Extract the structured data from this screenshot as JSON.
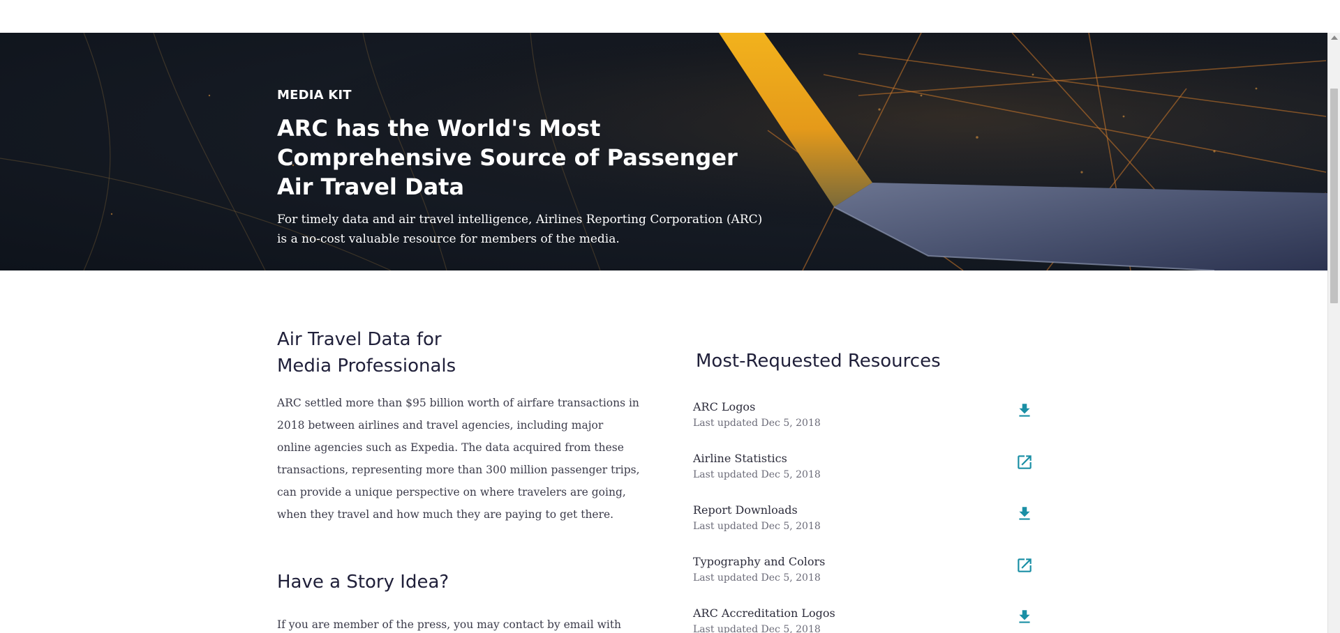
{
  "hero": {
    "kicker": "MEDIA KIT",
    "title": "ARC has the World's Most Comprehensive Source of Passenger Air Travel Data",
    "subtitle": "For timely data and air travel intelligence, Airlines Reporting Corporation (ARC) is a no-cost valuable resource for members of the media."
  },
  "intro": {
    "heading_line1": "Air Travel Data for",
    "heading_line2": "Media Professionals",
    "body": "ARC settled more than $95 billion worth of airfare transactions in 2018 between airlines and travel agencies, including major online agencies such as Expedia. The data acquired from these transactions, representing more than 300 million passenger trips, can provide a unique perspective on where travelers are going, when they travel and how much they are paying to get there."
  },
  "story": {
    "heading": "Have a Story Idea?",
    "body": "If you are member of the press, you may contact by email with your"
  },
  "resources": {
    "heading": "Most-Requested Resources",
    "accent_color": "#1a8fa5",
    "items": [
      {
        "title": "ARC Logos",
        "updated": "Last updated Dec 5, 2018",
        "icon": "download-icon"
      },
      {
        "title": "Airline Statistics",
        "updated": "Last updated Dec 5, 2018",
        "icon": "external-link-icon"
      },
      {
        "title": "Report Downloads",
        "updated": "Last updated Dec 5, 2018",
        "icon": "download-icon"
      },
      {
        "title": "Typography and Colors",
        "updated": "Last updated Dec 5, 2018",
        "icon": "external-link-icon"
      },
      {
        "title": "ARC Accreditation Logos",
        "updated": "Last updated Dec 5, 2018",
        "icon": "download-icon"
      }
    ]
  }
}
